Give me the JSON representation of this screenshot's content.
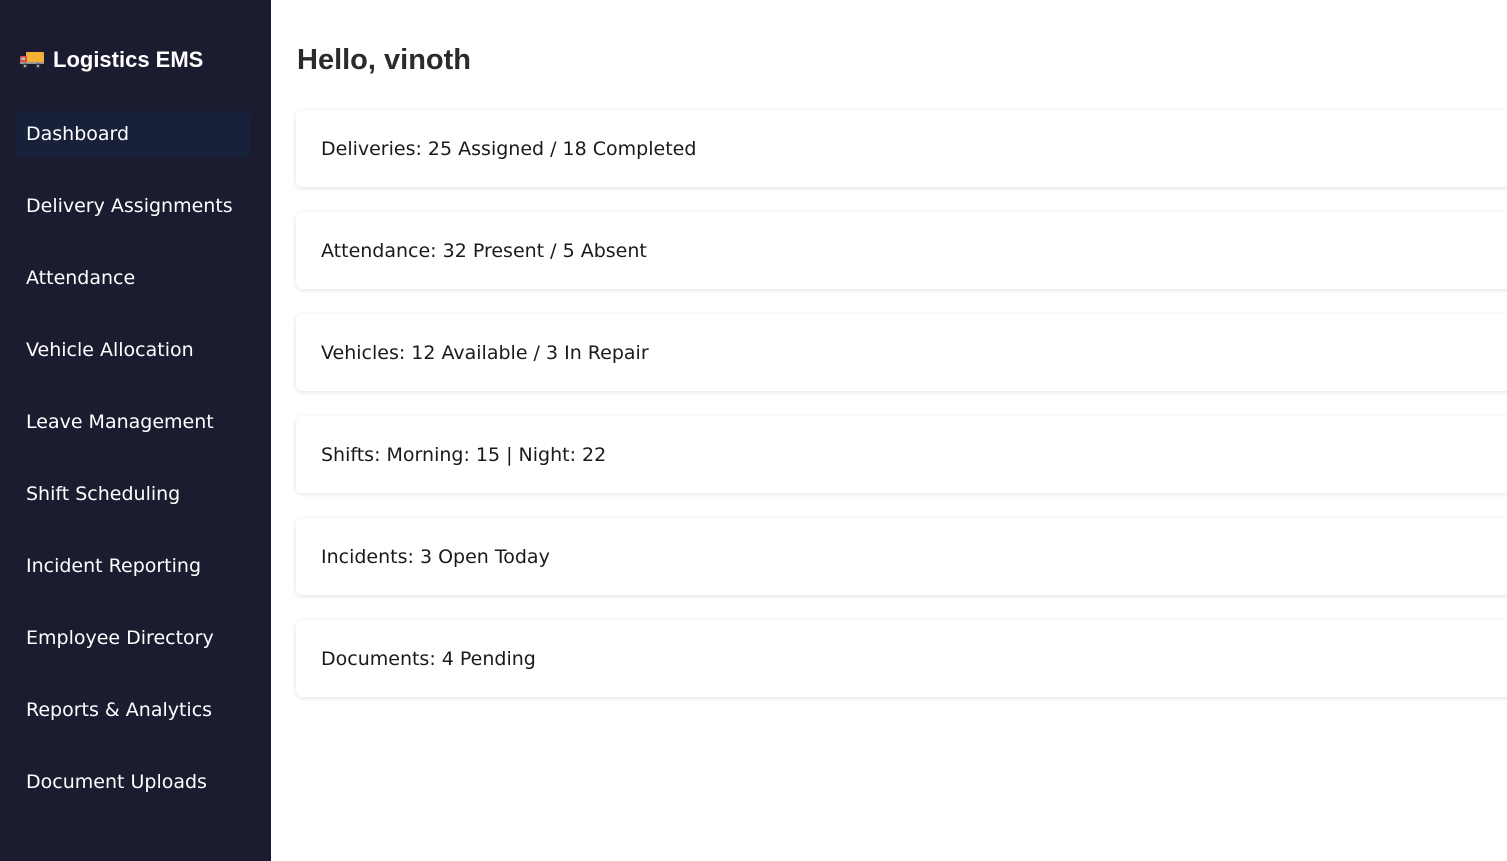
{
  "app": {
    "title": "Logistics EMS",
    "logo_icon": "delivery-truck-icon"
  },
  "sidebar": {
    "items": [
      {
        "label": "Dashboard",
        "active": true
      },
      {
        "label": "Delivery Assignments"
      },
      {
        "label": "Attendance"
      },
      {
        "label": "Vehicle Allocation"
      },
      {
        "label": "Leave Management"
      },
      {
        "label": "Shift Scheduling"
      },
      {
        "label": "Incident Reporting"
      },
      {
        "label": "Employee Directory"
      },
      {
        "label": "Reports & Analytics"
      },
      {
        "label": "Document Uploads"
      }
    ]
  },
  "main": {
    "greeting": "Hello, vinoth",
    "cards": [
      {
        "text": "Deliveries: 25 Assigned / 18 Completed"
      },
      {
        "text": "Attendance: 32 Present / 5 Absent"
      },
      {
        "text": "Vehicles: 12 Available / 3 In Repair"
      },
      {
        "text": "Shifts: Morning: 15 | Night: 22"
      },
      {
        "text": "Incidents: 3 Open Today"
      },
      {
        "text": "Documents: 4 Pending"
      }
    ]
  },
  "colors": {
    "sidebar_bg": "#1c1c30",
    "active_item_bg": "#18213a",
    "main_bg": "#ffffff"
  }
}
